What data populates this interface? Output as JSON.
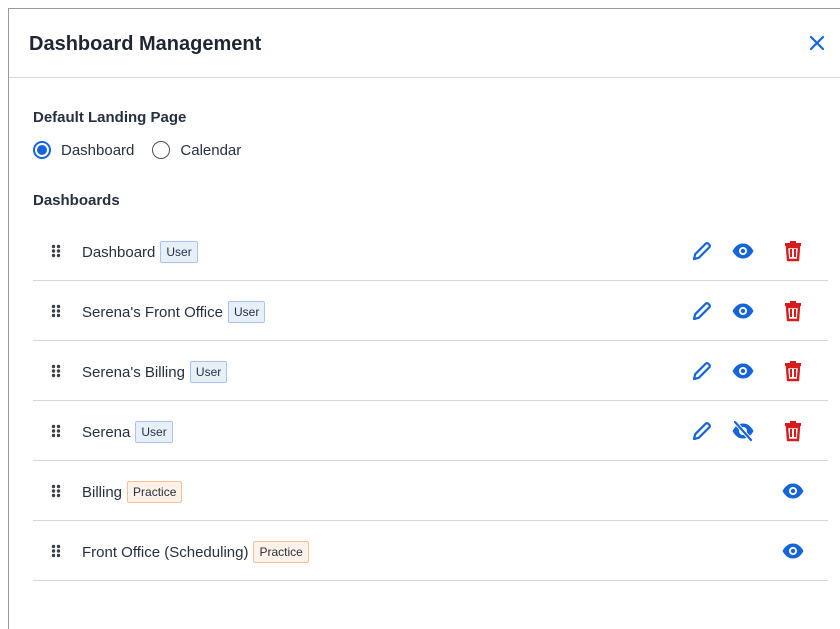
{
  "modal": {
    "title": "Dashboard Management",
    "close_icon": "close-icon",
    "accent_color": "#1565d8",
    "danger_color": "#d81b1b"
  },
  "landing": {
    "label": "Default Landing Page",
    "options": [
      {
        "label": "Dashboard",
        "selected": true
      },
      {
        "label": "Calendar",
        "selected": false
      }
    ]
  },
  "dashboards": {
    "label": "Dashboards",
    "rows": [
      {
        "name": "Dashboard",
        "badge": "User",
        "actions": [
          "edit",
          "view",
          "delete"
        ]
      },
      {
        "name": "Serena's Front Office",
        "badge": "User",
        "actions": [
          "edit",
          "view",
          "delete"
        ]
      },
      {
        "name": "Serena's Billing",
        "badge": "User",
        "actions": [
          "edit",
          "view",
          "delete"
        ]
      },
      {
        "name": "Serena",
        "badge": "User",
        "actions": [
          "edit",
          "hidden",
          "delete"
        ]
      },
      {
        "name": "Billing",
        "badge": "Practice",
        "actions": [
          "view"
        ]
      },
      {
        "name": "Front Office (Scheduling)",
        "badge": "Practice",
        "actions": [
          "view"
        ]
      }
    ]
  }
}
